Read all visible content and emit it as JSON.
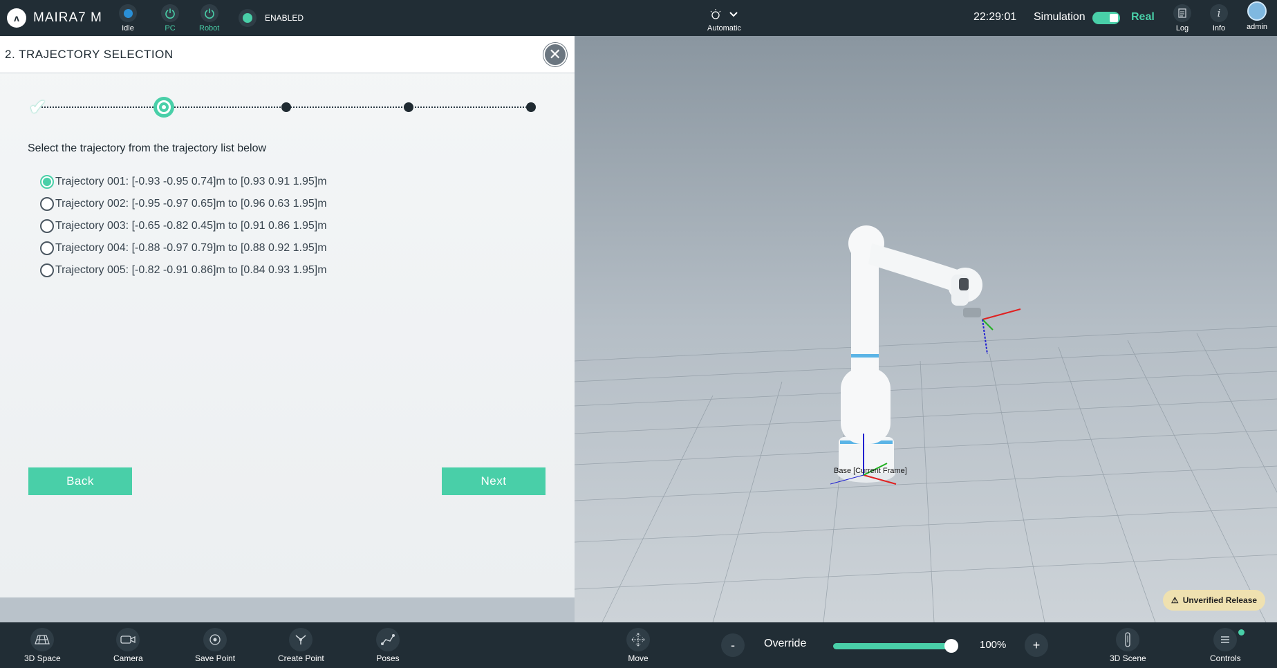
{
  "app": {
    "title": "MAIRA7 M",
    "logo_glyph": "ʌ"
  },
  "topbar": {
    "status_items": [
      {
        "label": "Idle",
        "icon": "status-dot-icon"
      },
      {
        "label": "PC",
        "icon": "power-icon"
      },
      {
        "label": "Robot",
        "icon": "power-icon"
      }
    ],
    "enabled_label": "ENABLED",
    "mode_label": "Automatic",
    "clock": "22:29:01",
    "simulation_label": "Simulation",
    "real_label": "Real",
    "log_label": "Log",
    "info_label": "Info",
    "user_label": "admin"
  },
  "panel": {
    "title": "2. TRAJECTORY SELECTION",
    "close_glyph": "✕",
    "instruction": "Select the trajectory from the trajectory list below",
    "trajectories": [
      {
        "label": "Trajectory 001: [-0.93 -0.95 0.74]m to [0.93 0.91 1.95]m",
        "checked": true
      },
      {
        "label": "Trajectory 002: [-0.95 -0.97 0.65]m to [0.96 0.63 1.95]m",
        "checked": false
      },
      {
        "label": "Trajectory 003: [-0.65 -0.82 0.45]m to [0.91 0.86 1.95]m",
        "checked": false
      },
      {
        "label": "Trajectory 004: [-0.88 -0.97 0.79]m to [0.88 0.92 1.95]m",
        "checked": false
      },
      {
        "label": "Trajectory 005: [-0.82 -0.91 0.86]m to [0.84 0.93 1.95]m",
        "checked": false
      }
    ],
    "back_label": "Back",
    "next_label": "Next",
    "steps_total": 5,
    "current_step": 2
  },
  "scene": {
    "frame_label": "Base [Current Frame]",
    "unverified_label": "Unverified Release"
  },
  "bottombar": {
    "items": [
      {
        "label": "3D Space",
        "icon": "3d-space-icon"
      },
      {
        "label": "Camera",
        "icon": "camera-icon"
      },
      {
        "label": "Save Point",
        "icon": "save-point-icon"
      },
      {
        "label": "Create Point",
        "icon": "create-point-icon"
      },
      {
        "label": "Poses",
        "icon": "poses-icon"
      },
      {
        "label": "Move",
        "icon": "move-icon"
      }
    ],
    "minus_label": "-",
    "override_label": "Override",
    "override_value": "100%",
    "override_fraction": 1.0,
    "plus_label": "+",
    "scene_label": "3D Scene",
    "controls_label": "Controls"
  },
  "colors": {
    "accent": "#49cfa8",
    "bar": "#212d35",
    "status_blue": "#2a8fd6"
  }
}
